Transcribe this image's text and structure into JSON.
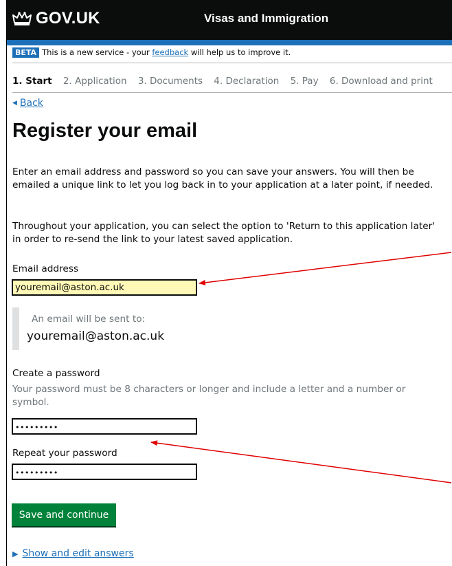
{
  "header": {
    "logo_text": "GOV.UK",
    "service_name": "Visas and Immigration",
    "crown_icon": "crown-icon"
  },
  "beta_banner": {
    "tag": "BETA",
    "text_before": "This is a new service - your ",
    "link": "feedback",
    "text_after": " will help us to improve it."
  },
  "steps": [
    {
      "label": "1. Start",
      "current": true
    },
    {
      "label": "2. Application",
      "current": false
    },
    {
      "label": "3. Documents",
      "current": false
    },
    {
      "label": "4. Declaration",
      "current": false
    },
    {
      "label": "5. Pay",
      "current": false
    },
    {
      "label": "6. Download and print",
      "current": false
    }
  ],
  "back_link": "Back",
  "page_title": "Register your email",
  "intro_paragraph": "Enter an email address and password so you can save your answers. You will then be emailed a unique link to let you log back in to your application at a later point, if needed.",
  "return_paragraph": "Throughout your application, you can select the option to 'Return to this application later' in order to re-send the link to your latest saved application.",
  "email": {
    "label": "Email address",
    "value": "youremail@aston.ac.uk"
  },
  "email_confirmation": {
    "label": "An email will be sent to:",
    "value": "youremail@aston.ac.uk"
  },
  "password": {
    "label": "Create a password",
    "hint": "Your password must be 8 characters or longer and include a letter and a number or symbol.",
    "value": "•••••••••"
  },
  "repeat_password": {
    "label": "Repeat your password",
    "value": "•••••••••"
  },
  "submit_button": "Save and continue",
  "details_link": "Show and edit answers",
  "colors": {
    "header_bg": "#0b0c0c",
    "brand_blue": "#1d70b8",
    "button_green": "#00823b",
    "highlight_yellow": "#fff8b7",
    "annotation_red": "#e00000"
  }
}
